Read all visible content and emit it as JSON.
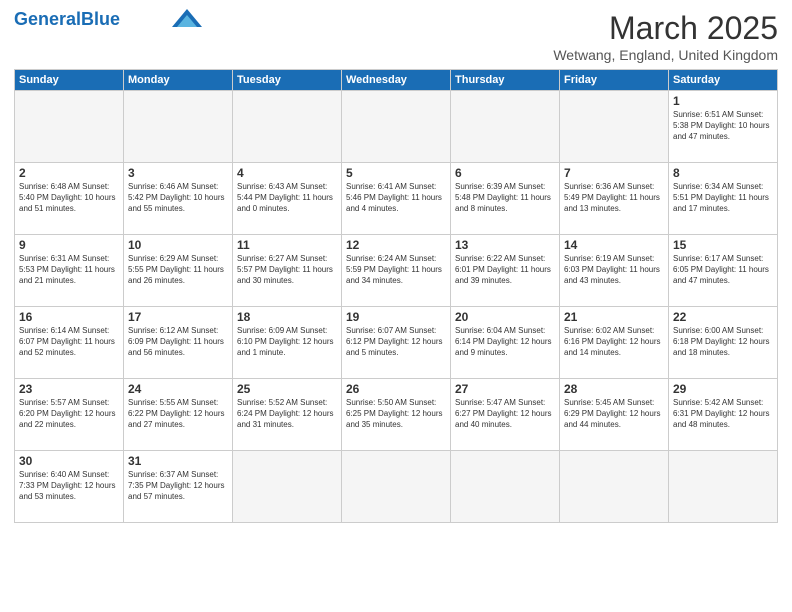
{
  "header": {
    "logo_general": "General",
    "logo_blue": "Blue",
    "month_title": "March 2025",
    "location": "Wetwang, England, United Kingdom"
  },
  "days_of_week": [
    "Sunday",
    "Monday",
    "Tuesday",
    "Wednesday",
    "Thursday",
    "Friday",
    "Saturday"
  ],
  "weeks": [
    [
      {
        "day": "",
        "info": "",
        "empty": true
      },
      {
        "day": "",
        "info": "",
        "empty": true
      },
      {
        "day": "",
        "info": "",
        "empty": true
      },
      {
        "day": "",
        "info": "",
        "empty": true
      },
      {
        "day": "",
        "info": "",
        "empty": true
      },
      {
        "day": "",
        "info": "",
        "empty": true
      },
      {
        "day": "1",
        "info": "Sunrise: 6:51 AM\nSunset: 5:38 PM\nDaylight: 10 hours and 47 minutes."
      }
    ],
    [
      {
        "day": "2",
        "info": "Sunrise: 6:48 AM\nSunset: 5:40 PM\nDaylight: 10 hours and 51 minutes."
      },
      {
        "day": "3",
        "info": "Sunrise: 6:46 AM\nSunset: 5:42 PM\nDaylight: 10 hours and 55 minutes."
      },
      {
        "day": "4",
        "info": "Sunrise: 6:43 AM\nSunset: 5:44 PM\nDaylight: 11 hours and 0 minutes."
      },
      {
        "day": "5",
        "info": "Sunrise: 6:41 AM\nSunset: 5:46 PM\nDaylight: 11 hours and 4 minutes."
      },
      {
        "day": "6",
        "info": "Sunrise: 6:39 AM\nSunset: 5:48 PM\nDaylight: 11 hours and 8 minutes."
      },
      {
        "day": "7",
        "info": "Sunrise: 6:36 AM\nSunset: 5:49 PM\nDaylight: 11 hours and 13 minutes."
      },
      {
        "day": "8",
        "info": "Sunrise: 6:34 AM\nSunset: 5:51 PM\nDaylight: 11 hours and 17 minutes."
      }
    ],
    [
      {
        "day": "9",
        "info": "Sunrise: 6:31 AM\nSunset: 5:53 PM\nDaylight: 11 hours and 21 minutes."
      },
      {
        "day": "10",
        "info": "Sunrise: 6:29 AM\nSunset: 5:55 PM\nDaylight: 11 hours and 26 minutes."
      },
      {
        "day": "11",
        "info": "Sunrise: 6:27 AM\nSunset: 5:57 PM\nDaylight: 11 hours and 30 minutes."
      },
      {
        "day": "12",
        "info": "Sunrise: 6:24 AM\nSunset: 5:59 PM\nDaylight: 11 hours and 34 minutes."
      },
      {
        "day": "13",
        "info": "Sunrise: 6:22 AM\nSunset: 6:01 PM\nDaylight: 11 hours and 39 minutes."
      },
      {
        "day": "14",
        "info": "Sunrise: 6:19 AM\nSunset: 6:03 PM\nDaylight: 11 hours and 43 minutes."
      },
      {
        "day": "15",
        "info": "Sunrise: 6:17 AM\nSunset: 6:05 PM\nDaylight: 11 hours and 47 minutes."
      }
    ],
    [
      {
        "day": "16",
        "info": "Sunrise: 6:14 AM\nSunset: 6:07 PM\nDaylight: 11 hours and 52 minutes."
      },
      {
        "day": "17",
        "info": "Sunrise: 6:12 AM\nSunset: 6:09 PM\nDaylight: 11 hours and 56 minutes."
      },
      {
        "day": "18",
        "info": "Sunrise: 6:09 AM\nSunset: 6:10 PM\nDaylight: 12 hours and 1 minute."
      },
      {
        "day": "19",
        "info": "Sunrise: 6:07 AM\nSunset: 6:12 PM\nDaylight: 12 hours and 5 minutes."
      },
      {
        "day": "20",
        "info": "Sunrise: 6:04 AM\nSunset: 6:14 PM\nDaylight: 12 hours and 9 minutes."
      },
      {
        "day": "21",
        "info": "Sunrise: 6:02 AM\nSunset: 6:16 PM\nDaylight: 12 hours and 14 minutes."
      },
      {
        "day": "22",
        "info": "Sunrise: 6:00 AM\nSunset: 6:18 PM\nDaylight: 12 hours and 18 minutes."
      }
    ],
    [
      {
        "day": "23",
        "info": "Sunrise: 5:57 AM\nSunset: 6:20 PM\nDaylight: 12 hours and 22 minutes."
      },
      {
        "day": "24",
        "info": "Sunrise: 5:55 AM\nSunset: 6:22 PM\nDaylight: 12 hours and 27 minutes."
      },
      {
        "day": "25",
        "info": "Sunrise: 5:52 AM\nSunset: 6:24 PM\nDaylight: 12 hours and 31 minutes."
      },
      {
        "day": "26",
        "info": "Sunrise: 5:50 AM\nSunset: 6:25 PM\nDaylight: 12 hours and 35 minutes."
      },
      {
        "day": "27",
        "info": "Sunrise: 5:47 AM\nSunset: 6:27 PM\nDaylight: 12 hours and 40 minutes."
      },
      {
        "day": "28",
        "info": "Sunrise: 5:45 AM\nSunset: 6:29 PM\nDaylight: 12 hours and 44 minutes."
      },
      {
        "day": "29",
        "info": "Sunrise: 5:42 AM\nSunset: 6:31 PM\nDaylight: 12 hours and 48 minutes."
      }
    ],
    [
      {
        "day": "30",
        "info": "Sunrise: 6:40 AM\nSunset: 7:33 PM\nDaylight: 12 hours and 53 minutes."
      },
      {
        "day": "31",
        "info": "Sunrise: 6:37 AM\nSunset: 7:35 PM\nDaylight: 12 hours and 57 minutes."
      },
      {
        "day": "",
        "info": "",
        "empty": true
      },
      {
        "day": "",
        "info": "",
        "empty": true
      },
      {
        "day": "",
        "info": "",
        "empty": true
      },
      {
        "day": "",
        "info": "",
        "empty": true
      },
      {
        "day": "",
        "info": "",
        "empty": true
      }
    ]
  ]
}
